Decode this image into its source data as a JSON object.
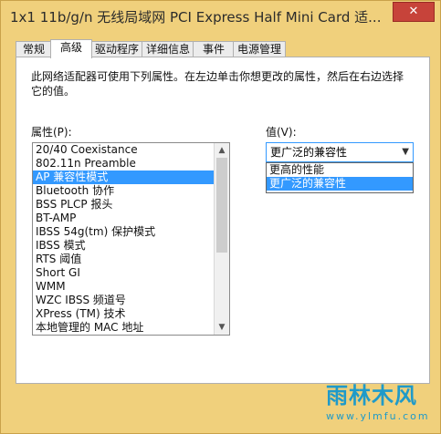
{
  "window": {
    "title": "1x1 11b/g/n 无线局域网 PCI Express Half Mini Card 适...",
    "close_glyph": "✕"
  },
  "tabs": [
    {
      "label": "常规"
    },
    {
      "label": "高级"
    },
    {
      "label": "驱动程序"
    },
    {
      "label": "详细信息"
    },
    {
      "label": "事件"
    },
    {
      "label": "电源管理"
    }
  ],
  "active_tab": "高级",
  "panel": {
    "description": "此网络适配器可使用下列属性。在左边单击你想更改的属性，然后在右边选择它的值。",
    "property_label": "属性(P):",
    "value_label": "值(V):"
  },
  "properties": [
    {
      "label": "20/40 Coexistance"
    },
    {
      "label": "802.11n Preamble"
    },
    {
      "label": "AP 兼容性模式",
      "selected": true
    },
    {
      "label": "Bluetooth 协作"
    },
    {
      "label": "BSS PLCP 报头"
    },
    {
      "label": "BT-AMP"
    },
    {
      "label": "IBSS 54g(tm) 保护模式"
    },
    {
      "label": "IBSS 模式"
    },
    {
      "label": "RTS 阈值"
    },
    {
      "label": "Short GI"
    },
    {
      "label": "WMM"
    },
    {
      "label": "WZC IBSS 频道号"
    },
    {
      "label": "XPress (TM) 技术"
    },
    {
      "label": "本地管理的 MAC 地址"
    }
  ],
  "value_select": {
    "current": "更广泛的兼容性",
    "options": [
      {
        "label": "更高的性能"
      },
      {
        "label": "更广泛的兼容性",
        "selected": true
      }
    ]
  },
  "watermark": {
    "text": "雨林木风",
    "url": "www.ylmfu.com"
  },
  "colors": {
    "selection": "#3399ff",
    "frame": "#f0d07c",
    "close": "#c7433a",
    "watermark": "#1f9ac9"
  }
}
